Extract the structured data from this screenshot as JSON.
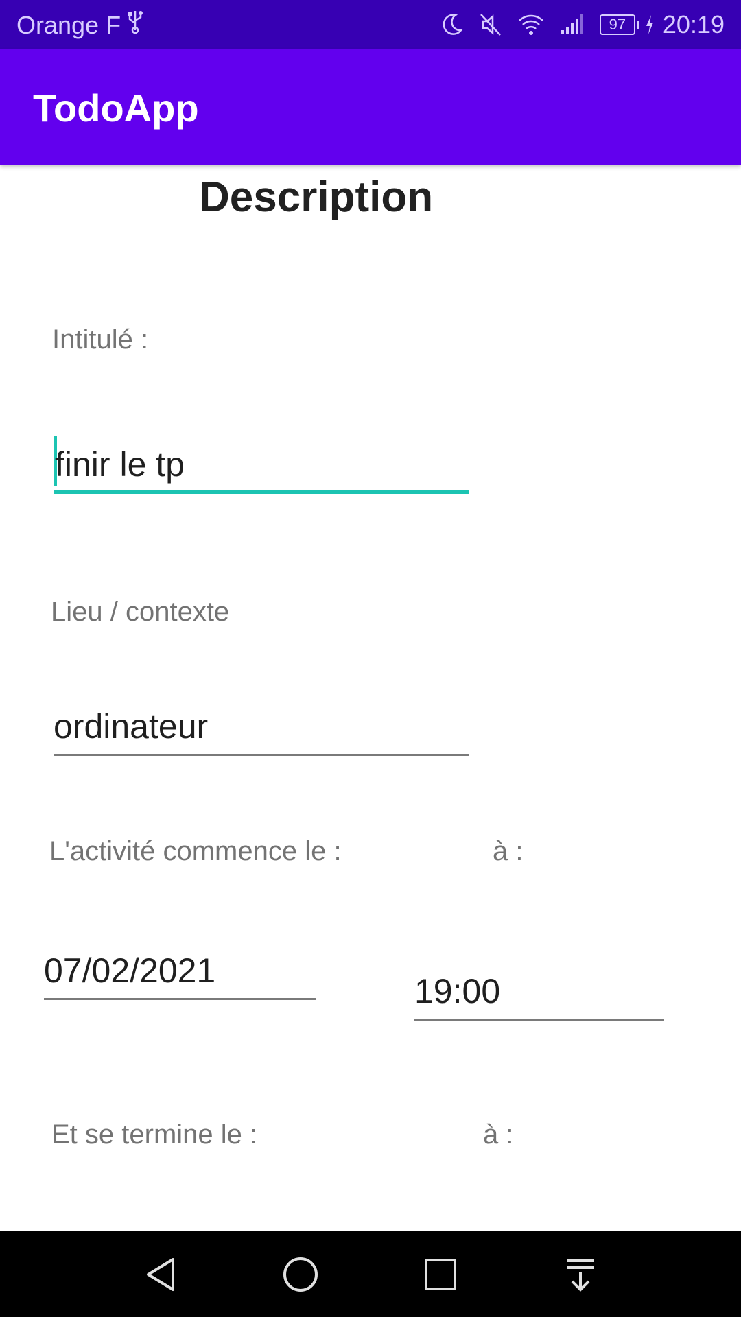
{
  "status_bar": {
    "carrier": "Orange F",
    "battery_level": "97",
    "time": "20:19",
    "icons": [
      "usb-icon",
      "moon-icon",
      "mute-icon",
      "wifi-icon",
      "signal-icon",
      "battery-icon",
      "charging-icon"
    ]
  },
  "app_bar": {
    "title": "TodoApp",
    "color": "#6200ee"
  },
  "form": {
    "heading": "Description",
    "title_label": "Intitulé :",
    "title_value": "finir le tp",
    "place_label": "Lieu / contexte",
    "place_value": "ordinateur",
    "start_label": "L'activité commence le :",
    "start_time_label": "à :",
    "start_date_value": "07/02/2021",
    "start_time_value": "19:00",
    "end_label": "Et se termine le :",
    "end_time_label": "à :"
  },
  "colors": {
    "status_bar": "#3700b3",
    "accent": "#1cc4b2"
  },
  "nav_bar": {
    "buttons": [
      "back-icon",
      "home-icon",
      "recents-icon",
      "notification-shade-icon"
    ]
  }
}
